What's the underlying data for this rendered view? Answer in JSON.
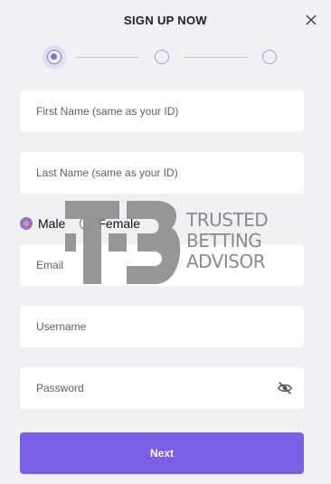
{
  "header": {
    "title": "SIGN UP NOW",
    "close_icon": "close-icon"
  },
  "steps": {
    "count": 3,
    "active_index": 0
  },
  "form": {
    "first_name_placeholder": "First Name (same as your ID)",
    "last_name_placeholder": "Last Name (same as your ID)",
    "gender": {
      "options": [
        "Male",
        "Female"
      ],
      "selected": "Male"
    },
    "email_placeholder": "Email",
    "username_placeholder": "Username",
    "password_placeholder": "Password",
    "password_toggle_icon": "eye-slash-icon",
    "next_label": "Next"
  },
  "watermark": {
    "lines": [
      "TRUSTED",
      "BETTING",
      "ADVISOR"
    ]
  },
  "colors": {
    "accent": "#7b5ee6",
    "background": "#f1f1f3",
    "radio_dot": "#e9a046"
  }
}
